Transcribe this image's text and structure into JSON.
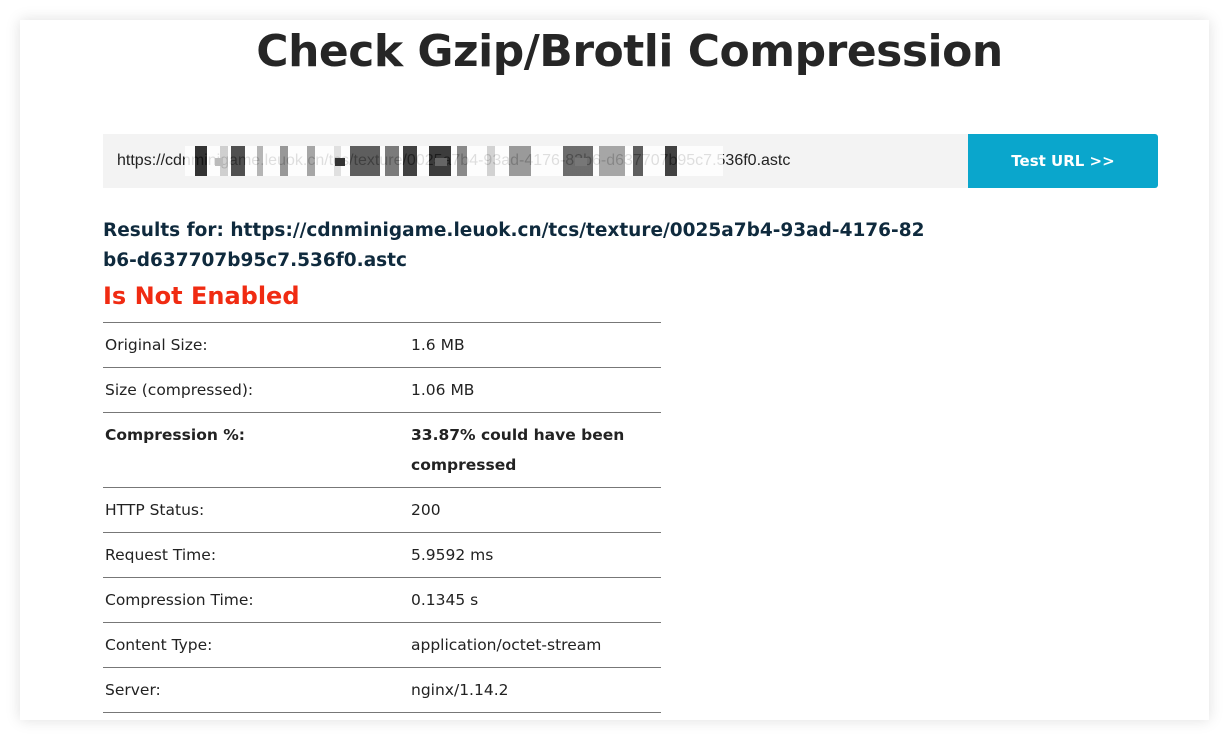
{
  "page": {
    "title": "Check Gzip/Brotli Compression"
  },
  "search": {
    "url_value": "https://cdnminigame.leuok.cn/tcs/texture/0025a7b4-93ad-4176-82b6-d637707b95c7.536f0.astc",
    "button_label": "Test URL >>"
  },
  "results": {
    "heading": "Results for: https://cdnminigame.leuok.cn/tcs/texture/0025a7b4-93ad-4176-82b6-d637707b95c7.536f0.astc",
    "status": "Is Not Enabled",
    "rows": [
      {
        "label": "Original Size:",
        "value": "1.6 MB"
      },
      {
        "label": "Size (compressed):",
        "value": "1.06 MB"
      },
      {
        "label": "Compression %:",
        "value": "33.87% could have been compressed"
      },
      {
        "label": "HTTP Status:",
        "value": "200"
      },
      {
        "label": "Request Time:",
        "value": "5.9592 ms"
      },
      {
        "label": "Compression Time:",
        "value": "0.1345 s"
      },
      {
        "label": "Content Type:",
        "value": "application/octet-stream"
      },
      {
        "label": "Server:",
        "value": "nginx/1.14.2"
      }
    ]
  },
  "colors": {
    "button": "#0aa6cc",
    "status_red": "#f02b12",
    "heading_navy": "#0f2a3d"
  }
}
